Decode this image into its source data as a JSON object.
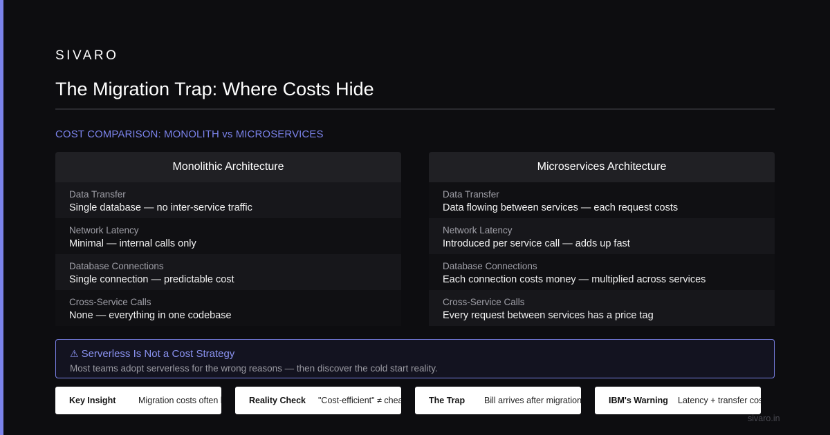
{
  "brand": "SIVARO",
  "title": "The Migration Trap: Where Costs Hide",
  "section_label": "COST COMPARISON: MONOLITH vs MICROSERVICES",
  "colors": {
    "accent": "#7b83eb",
    "background": "#0d0d10"
  },
  "monolith": {
    "header": "Monolithic Architecture",
    "rows": [
      {
        "label": "Data Transfer",
        "value": "Single database — no inter-service traffic"
      },
      {
        "label": "Network Latency",
        "value": "Minimal — internal calls only"
      },
      {
        "label": "Database Connections",
        "value": "Single connection — predictable cost"
      },
      {
        "label": "Cross-Service Calls",
        "value": "None — everything in one codebase"
      }
    ]
  },
  "microservices": {
    "header": "Microservices Architecture",
    "rows": [
      {
        "label": "Data Transfer",
        "value": "Data flowing between services — each request costs"
      },
      {
        "label": "Network Latency",
        "value": "Introduced per service call — adds up fast"
      },
      {
        "label": "Database Connections",
        "value": "Each connection costs money — multiplied across services"
      },
      {
        "label": "Cross-Service Calls",
        "value": "Every request between services has a price tag"
      }
    ]
  },
  "callout": {
    "icon": "warning-icon",
    "icon_glyph": "⚠",
    "title": "Serverless Is Not a Cost Strategy",
    "subtitle": "Most teams adopt serverless for the wrong reasons — then discover the cold start reality."
  },
  "cards": [
    {
      "key": "Key Insight",
      "value": "Migration costs often hide"
    },
    {
      "key": "Reality Check",
      "value": "\"Cost-efficient\" ≠ cheap"
    },
    {
      "key": "The Trap",
      "value": "Bill arrives after migration"
    },
    {
      "key": "IBM's Warning",
      "value": "Latency + transfer costs"
    }
  ],
  "footer": "sivaro.in"
}
